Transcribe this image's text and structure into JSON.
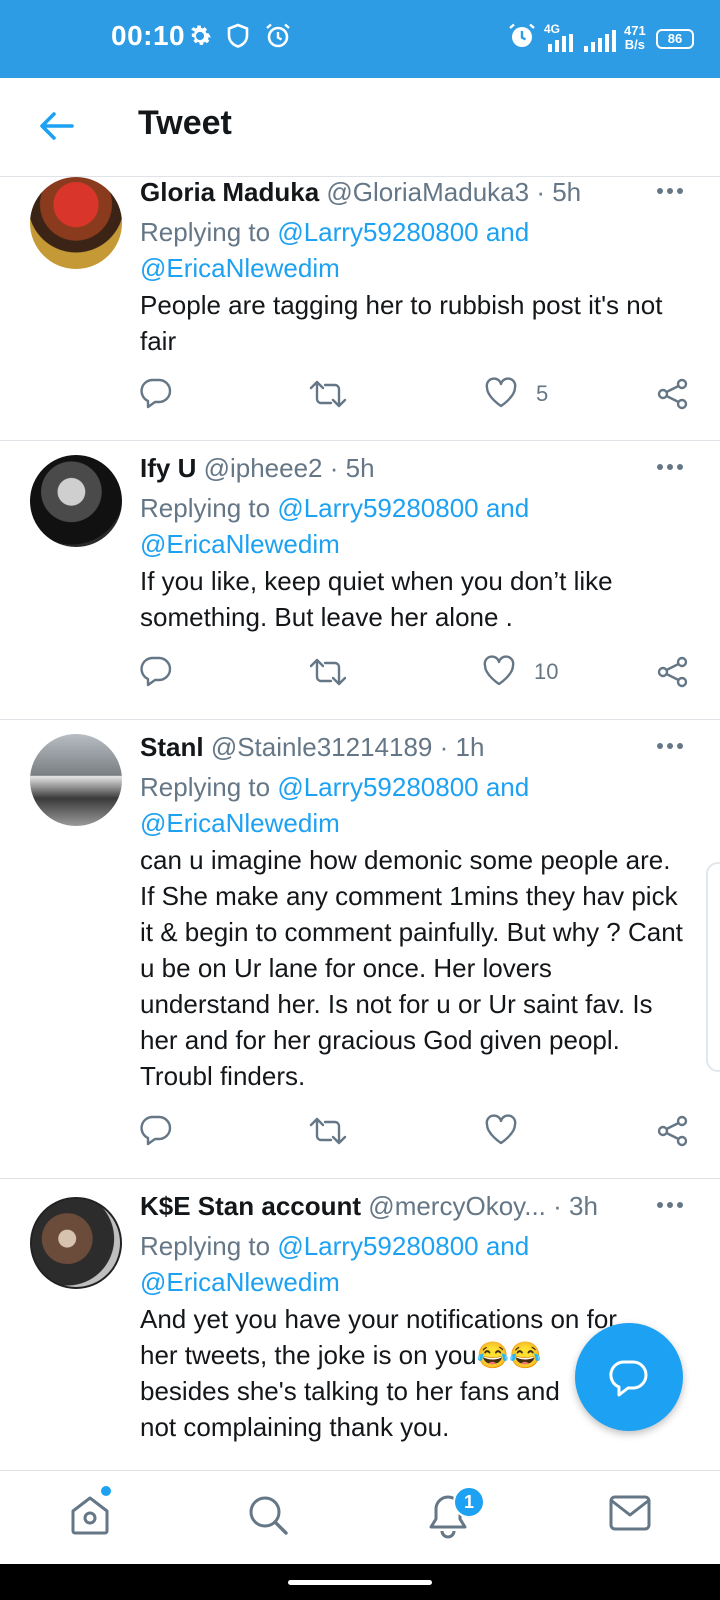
{
  "status_bar": {
    "time": "00:10",
    "net_speed_value": "471",
    "net_speed_unit": "B/s",
    "network_label": "4G",
    "battery": "86",
    "icons": [
      "gear-icon",
      "shield-icon",
      "alarm-icon",
      "alarm-icon",
      "signal-icon",
      "signal-icon",
      "battery-icon"
    ]
  },
  "header": {
    "title": "Tweet",
    "back_icon": "arrow-left-icon"
  },
  "tweets": [
    {
      "name": "Gloria Maduka",
      "handle": "@GloriaMaduka3",
      "time": "· 5h",
      "replying_prefix": "Replying to ",
      "mention1": "@Larry59280800",
      "and": " and",
      "mention2": "@EricaNlewedim",
      "text": "People are tagging her to rubbish post it's not fair",
      "likes": "5"
    },
    {
      "name": "Ify U",
      "handle": "@ipheee2",
      "time": "· 5h",
      "replying_prefix": "Replying to ",
      "mention1": "@Larry59280800",
      "and": " and",
      "mention2": "@EricaNlewedim",
      "text": "If you like, keep quiet when you don’t like something. But leave her alone .",
      "likes": "10"
    },
    {
      "name": "Stanl",
      "handle": "@Stainle31214189",
      "time": "· 1h",
      "replying_prefix": "Replying to ",
      "mention1": "@Larry59280800",
      "and": " and",
      "mention2": "@EricaNlewedim",
      "text": "can u  imagine how demonic some people are. If She make any comment 1mins they hav pick it & begin to comment painfully. But why ? Cant u be on Ur lane for once. Her lovers understand her. Is not for u or Ur saint fav. Is her and for her gracious God given peopl. Troubl finders.",
      "likes": ""
    },
    {
      "name": "K$E Stan account",
      "handle": "@mercyOkoy...",
      "time": "· 3h",
      "replying_prefix": "Replying to ",
      "mention1": "@Larry59280800",
      "and": " and",
      "mention2": "@EricaNlewedim",
      "line1": "And yet you have your notifications on for",
      "line2": "her tweets, the joke is on you😂😂",
      "line3": "besides she's talking to her fans and",
      "line4": "not complaining thank you."
    }
  ],
  "fab": {
    "icon": "compose-reply-icon"
  },
  "bottom_nav": {
    "items": [
      "home-icon",
      "search-icon",
      "notifications-icon",
      "messages-icon"
    ],
    "notification_badge": "1"
  },
  "colors": {
    "accent": "#1da1f2",
    "status_bar": "#2d9ce4",
    "secondary_text": "#657786",
    "divider": "#dfe3e7"
  }
}
